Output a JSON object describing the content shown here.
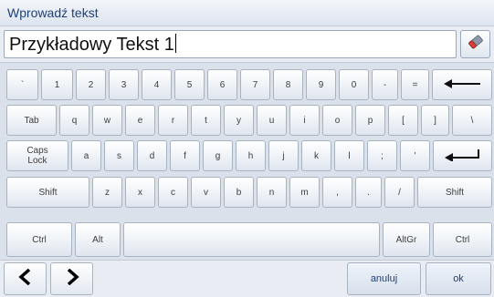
{
  "window": {
    "title": "Wprowadź tekst"
  },
  "input": {
    "value": "Przykładowy Tekst 1"
  },
  "eraser_icon": "eraser-icon",
  "keyboard": {
    "row1": [
      "`",
      "1",
      "2",
      "3",
      "4",
      "5",
      "6",
      "7",
      "8",
      "9",
      "0",
      "-",
      "="
    ],
    "backspace_icon": "left-arrow-icon",
    "row2": [
      "Tab",
      "q",
      "w",
      "e",
      "r",
      "t",
      "y",
      "u",
      "i",
      "o",
      "p",
      "[",
      "]",
      "\\"
    ],
    "row3": [
      "Caps\nLock",
      "a",
      "s",
      "d",
      "f",
      "g",
      "h",
      "j",
      "k",
      "l",
      ";",
      "'"
    ],
    "enter_icon": "enter-arrow-icon",
    "row4": [
      "Shift",
      "z",
      "x",
      "c",
      "v",
      "b",
      "n",
      "m",
      ",",
      ".",
      "/",
      "Shift"
    ],
    "row5": {
      "ctrl_left": "Ctrl",
      "alt": "Alt",
      "altgr": "AltGr",
      "ctrl_right": "Ctrl"
    }
  },
  "navigation": {
    "prev_icon": "chevron-left-icon",
    "next_icon": "chevron-right-icon"
  },
  "actions": {
    "cancel": "anuluj",
    "ok": "ok"
  },
  "colors": {
    "title_text": "#1f3f7a",
    "background": "#e9edf3",
    "keyboard_bg": "#dbe1ea"
  }
}
